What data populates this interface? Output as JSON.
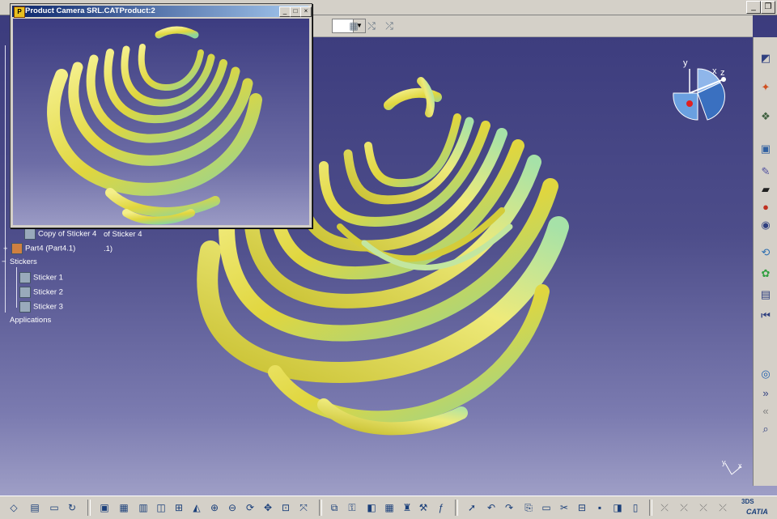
{
  "sub_window": {
    "title": "Product Camera SRL.CATProduct:2",
    "app_icon": "catia-product-icon",
    "min_label": "_",
    "max_label": "□",
    "close_label": "×"
  },
  "main_window": {
    "min_label": "_",
    "restore_label": "❐",
    "close_label": "×"
  },
  "tree": {
    "copy_sticker_label": "Copy of Sticker 4",
    "copy_sticker_suffix": "of Sticker 4",
    "part4_label": "Part4 (Part4.1)",
    "part4_suffix": ".1)",
    "stickers_label": "Stickers",
    "sticker1": "Sticker 1",
    "sticker2": "Sticker 2",
    "sticker3": "Sticker 3",
    "applications_label": "Applications"
  },
  "compass": {
    "y_label": "y",
    "x_label": "x",
    "z_label": "z"
  },
  "corner_axes": {
    "x_label": "x",
    "y_label": "y"
  },
  "brand": {
    "logo_text": "CATIA",
    "logo_prefix": "3DS"
  },
  "colors": {
    "viewport_top": "#3a3a7c",
    "viewport_bottom": "#a8a8cc",
    "ribbon_yellow": "#e6e04a",
    "ribbon_green": "#8fd49a",
    "chrome": "#d4d0c8"
  }
}
